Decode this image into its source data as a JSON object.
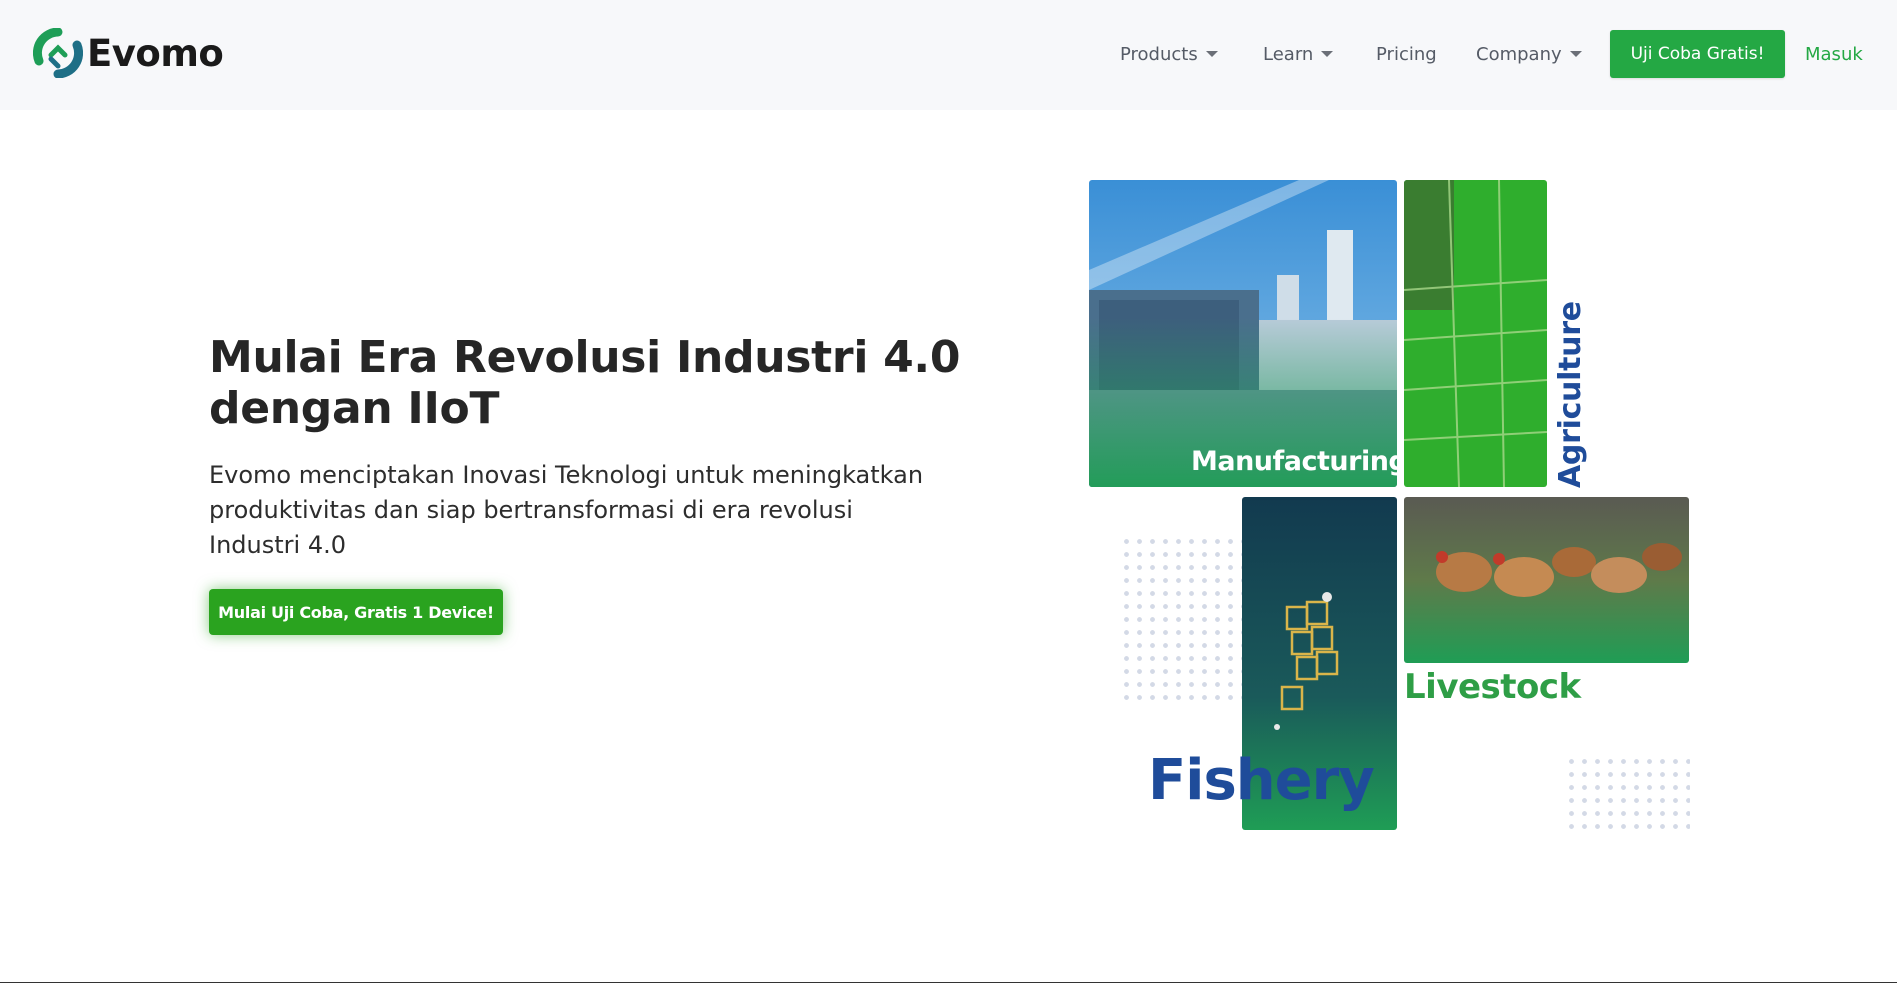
{
  "header": {
    "brand": "Evomo",
    "nav": [
      {
        "label": "Products",
        "has_dropdown": true
      },
      {
        "label": "Learn",
        "has_dropdown": true
      },
      {
        "label": "Pricing",
        "has_dropdown": false
      },
      {
        "label": "Company",
        "has_dropdown": true
      }
    ],
    "cta_label": "Uji Coba Gratis!",
    "login_label": "Masuk"
  },
  "hero": {
    "title": "Mulai Era Revolusi Industri 4.0 dengan IIoT",
    "subtitle": "Evomo menciptakan Inovasi Teknologi untuk meningkatkan produktivitas dan siap bertransformasi di era revolusi Industri 4.0",
    "button_label": "Mulai Uji Coba, Gratis 1 Device!"
  },
  "collage": {
    "manufacturing": "Manufacturing",
    "agriculture": "Agriculture",
    "livestock": "Livestock",
    "fishery": "Fishery"
  },
  "colors": {
    "brand_green": "#24a844",
    "hero_button": "#2aa31f",
    "label_blue": "#1f4c9a",
    "label_green": "#2e9e46",
    "header_bg": "#f7f8fa"
  },
  "icons": [
    "evomo-logo-icon",
    "chevron-down-icon"
  ]
}
